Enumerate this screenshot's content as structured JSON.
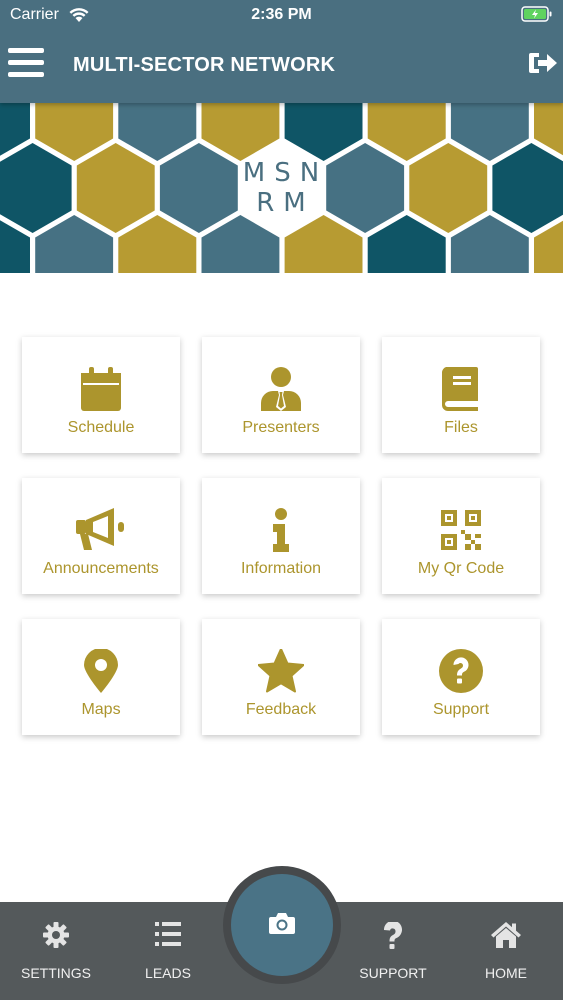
{
  "status_bar": {
    "carrier": "Carrier",
    "time": "2:36 PM"
  },
  "header": {
    "title": "MULTI-SECTOR NETWORK",
    "menu_icon": "hamburger-menu-icon",
    "logout_icon": "sign-out-icon"
  },
  "banner": {
    "logo_line1": "MSN",
    "logo_line2": "RM",
    "colors": {
      "teal": "#0f5566",
      "slate": "#467183",
      "gold": "#b79b32"
    }
  },
  "tiles": [
    {
      "label": "Schedule",
      "icon": "calendar-icon"
    },
    {
      "label": "Presenters",
      "icon": "user-tie-icon"
    },
    {
      "label": "Files",
      "icon": "book-icon"
    },
    {
      "label": "Announcements",
      "icon": "megaphone-icon"
    },
    {
      "label": "Information",
      "icon": "info-icon"
    },
    {
      "label": "My Qr Code",
      "icon": "qr-code-icon"
    },
    {
      "label": "Maps",
      "icon": "map-marker-icon"
    },
    {
      "label": "Feedback",
      "icon": "star-icon"
    },
    {
      "label": "Support",
      "icon": "question-circle-icon"
    }
  ],
  "tabbar": [
    {
      "label": "SETTINGS",
      "icon": "gear-icon"
    },
    {
      "label": "LEADS",
      "icon": "list-icon"
    },
    {
      "label": "",
      "icon": "camera-icon"
    },
    {
      "label": "SUPPORT",
      "icon": "question-icon"
    },
    {
      "label": "HOME",
      "icon": "home-icon"
    }
  ],
  "colors": {
    "header": "#4a6f80",
    "accent_gold": "#ac952d",
    "tabbar": "#54595b",
    "camera_button": "#4a7386"
  }
}
